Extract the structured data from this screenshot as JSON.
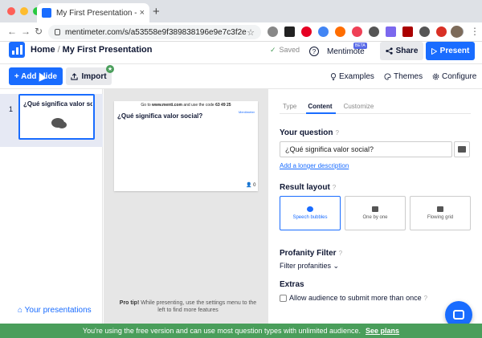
{
  "browser": {
    "tab_title": "My First Presentation - Mentimeter",
    "tab_close": "×",
    "new_tab": "+",
    "url": "mentimeter.com/s/a53558e9f389838196e9e7c3f2e6e461...",
    "back": "←",
    "forward": "→",
    "reload": "↻",
    "star": "☆",
    "menu": "⋮"
  },
  "header": {
    "home": "Home",
    "separator": "/",
    "presentation_title": "My First Presentation",
    "saved": "Saved",
    "saved_check": "✓",
    "mentimote": "Mentimote",
    "help_q": "?",
    "beta": "BETA",
    "share": "Share",
    "present": "Present",
    "colors": {
      "accent": "#196cff",
      "banner": "#4a9e5b"
    }
  },
  "toolbar": {
    "add_slide": "+ Add slide",
    "import": "Import",
    "import_icon": "upload-icon",
    "badge": "★",
    "examples": "Examples",
    "themes": "Themes",
    "configure": "Configure"
  },
  "slides": [
    {
      "number": "1",
      "title": "¿Qué significa valor social?",
      "type_icon": "speech-bubbles-icon"
    }
  ],
  "sidebar": {
    "your_presentations": "Your presentations"
  },
  "preview": {
    "goto_prefix": "Go to ",
    "goto_site": "www.menti.com",
    "goto_mid": " and use the code ",
    "code": "63 49 25",
    "brand": "Mentimeter",
    "question": "¿Qué significa valor social?",
    "responses": "0"
  },
  "tip": {
    "label": "Pro tip!",
    "text": " While presenting, use the settings menu to the left to find more features"
  },
  "panel": {
    "tabs": [
      "Type",
      "Content",
      "Customize"
    ],
    "active_tab": "Content",
    "your_question_label": "Your question",
    "question_value": "¿Qué significa valor social?",
    "longer_description": "Add a longer description",
    "result_layout_label": "Result layout",
    "layouts": [
      "Speech bubbles",
      "One by one",
      "Flowing grid"
    ],
    "selected_layout": "Speech bubbles",
    "profanity_label": "Profanity Filter",
    "profanity_value": "Filter profanities",
    "extras_label": "Extras",
    "allow_more": "Allow audience to submit more than once",
    "help": "?"
  },
  "banner": {
    "text": "You're using the free version and can use most question types with unlimited audience.",
    "link": "See plans"
  }
}
